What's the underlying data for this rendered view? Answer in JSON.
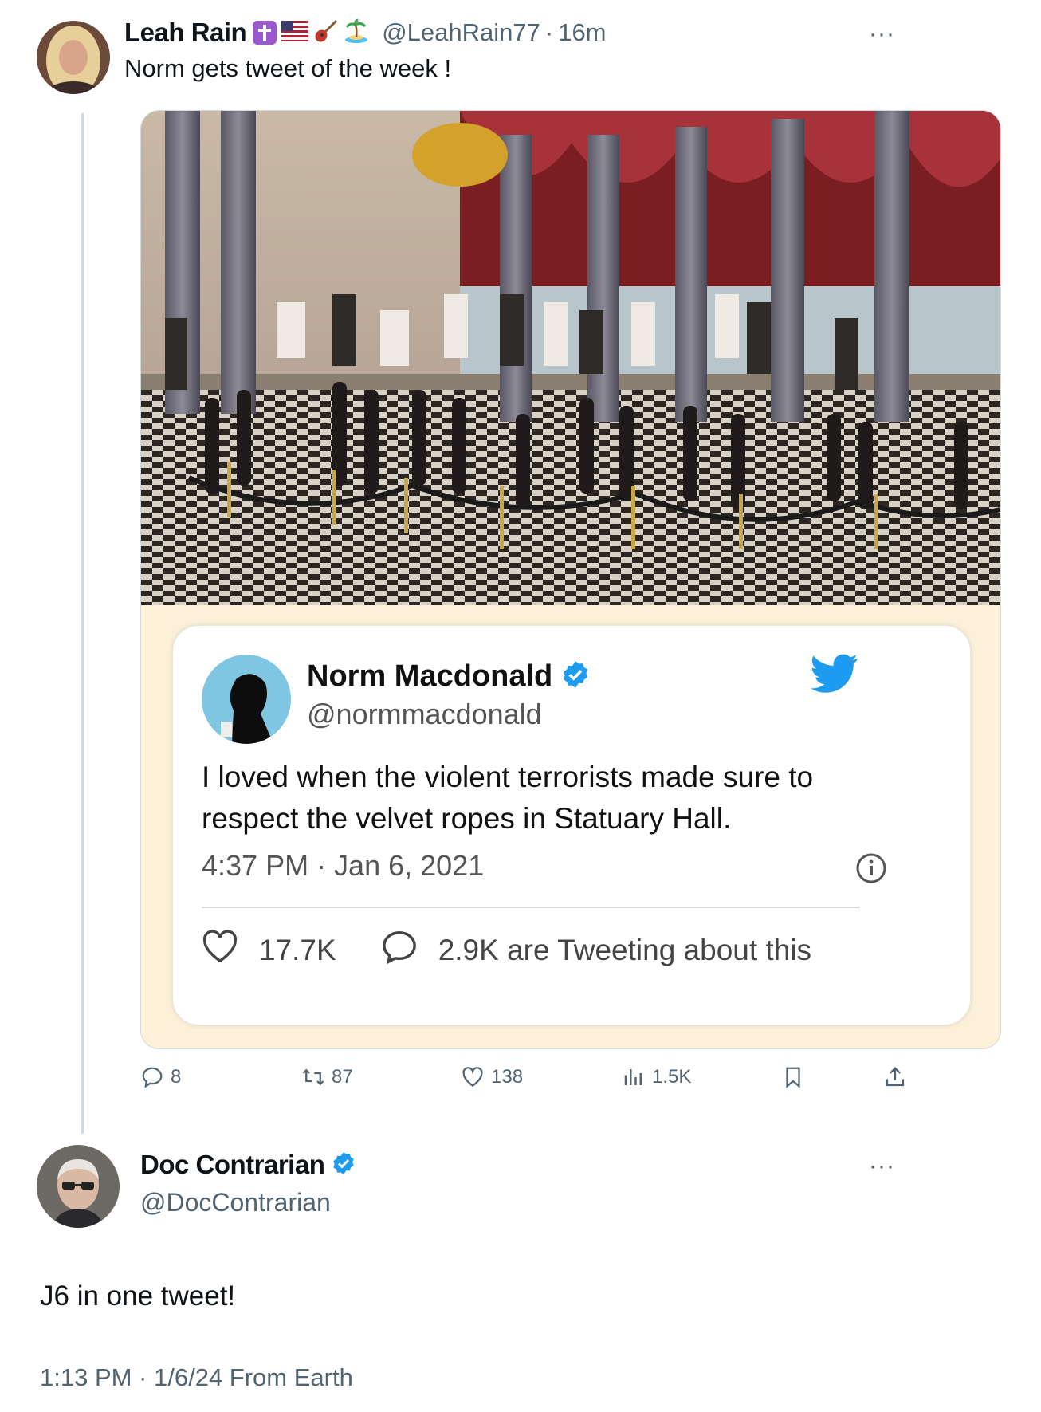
{
  "tweet1": {
    "author_name": "Leah Rain",
    "emoji_flair": [
      "cross-emoji",
      "us-flag-emoji",
      "guitar-emoji",
      "island-emoji"
    ],
    "handle": "@LeahRain77",
    "separator": "·",
    "time_ago": "16m",
    "text": "Norm gets tweet of the week !",
    "more": "···",
    "actions": {
      "reply_count": "8",
      "retweet_count": "87",
      "like_count": "138",
      "views_count": "1.5K"
    }
  },
  "embedded": {
    "author_name": "Norm Macdonald",
    "handle": "@normmacdonald",
    "text_line1": "I loved when the violent terrorists made sure to",
    "text_line2": "respect the velvet ropes in Statuary Hall.",
    "timestamp": "4:37 PM · Jan 6, 2021",
    "likes": "17.7K",
    "tweeting": "2.9K are Tweeting about this"
  },
  "tweet2": {
    "author_name": "Doc Contrarian",
    "handle": "@DocContrarian",
    "more": "···",
    "text": "J6 in one tweet!",
    "meta": "1:13 PM · 1/6/24 From Earth"
  },
  "colors": {
    "verified_blue": "#1d9bf0",
    "muted_text": "#536471",
    "card_background": "#fcf1d8"
  }
}
